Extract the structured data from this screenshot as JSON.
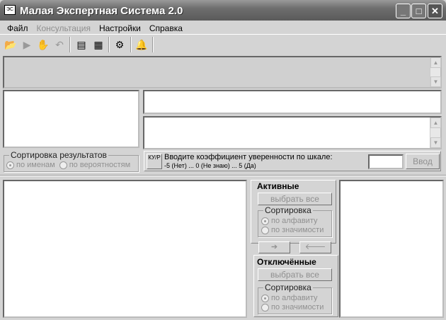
{
  "window": {
    "title": "Малая Экспертная Система 2.0",
    "icon_text": "ЭС",
    "minimize": "_",
    "maximize": "□",
    "close": "✕"
  },
  "menu": [
    "Файл",
    "Консультация",
    "Настройки",
    "Справка"
  ],
  "toolbar": [
    "open-icon",
    "run-icon",
    "stop-icon",
    "undo-icon",
    "export-icon",
    "import-icon",
    "settings-icon",
    "help-icon"
  ],
  "sort_results": {
    "label": "Сортировка результатов",
    "by_name": "по именам",
    "by_prob": "по вероятностям"
  },
  "prompt": {
    "ky_button": "КУ/Р",
    "line1": "Вводите коэффициент уверенности по шкале:",
    "line2": "-5 (Нет) ... 0 (Не знаю) ... 5 (Да)",
    "input_value": "",
    "enter_button": "Ввод"
  },
  "active": {
    "title": "Активные",
    "select_all": "выбрать все",
    "sort_label": "Сортировка",
    "alpha": "по алфавиту",
    "signif": "по значимости"
  },
  "move": {
    "right": "➔",
    "left": "🡐"
  },
  "disabled": {
    "title": "Отключённые",
    "select_all": "выбрать все",
    "sort_label": "Сортировка",
    "alpha": "по алфавиту",
    "signif": "по значимости"
  }
}
